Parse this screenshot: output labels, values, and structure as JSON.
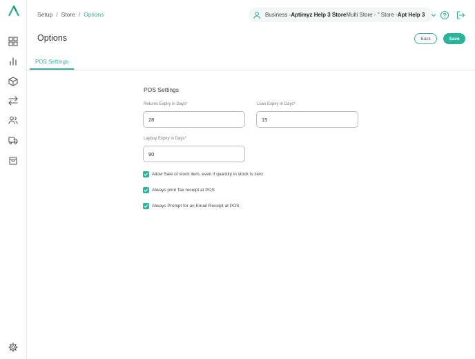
{
  "breadcrumb": {
    "items": [
      "Setup",
      "Store",
      "Options"
    ],
    "separator": "/"
  },
  "business": {
    "prefix": "Business - ",
    "name_bold": "Aptimyz Help 3 Store",
    "name_rest": " Multi Store - \" Store - ",
    "store_bold": "Apt Help 3"
  },
  "page": {
    "title": "Options",
    "back_label": "Back",
    "save_label": "Save"
  },
  "tabs": [
    {
      "label": "POS Settings",
      "active": true
    }
  ],
  "form": {
    "section_title": "POS Settings",
    "returns": {
      "label": "Returns Expiry in Days*",
      "value": "28"
    },
    "loan": {
      "label": "Loan Expiry in Days*",
      "value": "15"
    },
    "laybuy": {
      "label": "Laybuy Expiry in Days*",
      "value": "90"
    },
    "checkboxes": [
      {
        "label": "Allow Sale of stock item, even if quantity in stock is zero",
        "checked": true
      },
      {
        "label": "Always print Tax receipt at POS",
        "checked": true
      },
      {
        "label": "Always Prompt for an Email Receipt at POS",
        "checked": true
      }
    ]
  },
  "colors": {
    "accent": "#2ab49a",
    "text": "#333333",
    "border": "#bbbbbb"
  },
  "icons": {
    "logo": "aptimyz-logo-icon",
    "sidebar": [
      "dashboard-grid-icon",
      "bar-chart-icon",
      "box-icon",
      "transfer-arrows-icon",
      "users-icon",
      "truck-icon",
      "shopping-bag-icon",
      "settings-gear-icon"
    ],
    "header": [
      "user-icon",
      "chevron-down-icon",
      "help-icon",
      "logout-icon"
    ]
  }
}
